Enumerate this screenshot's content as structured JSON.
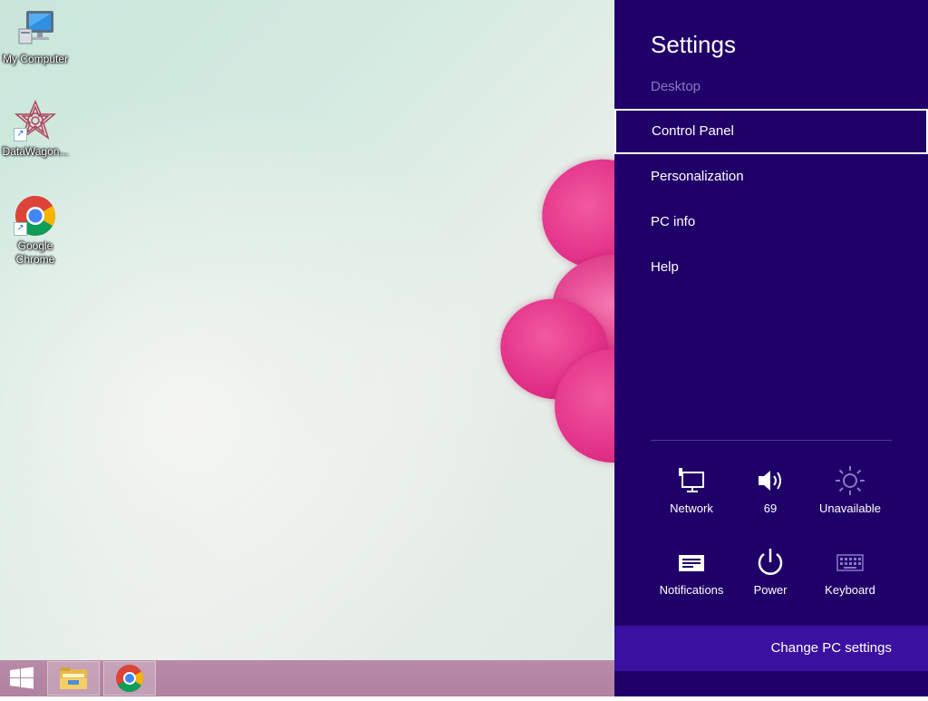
{
  "desktop": {
    "icons": [
      {
        "label": "My Computer",
        "icon": "my-computer-icon"
      },
      {
        "label": "DataWagon...",
        "icon": "datawagon-icon"
      },
      {
        "label": "Google Chrome",
        "icon": "chrome-icon"
      }
    ]
  },
  "taskbar": {
    "start": "windows-logo-icon",
    "pinned": [
      "file-explorer-icon",
      "chrome-icon"
    ]
  },
  "settings_charm": {
    "title": "Settings",
    "context": "Desktop",
    "items": [
      "Control Panel",
      "Personalization",
      "PC info",
      "Help"
    ],
    "selected_item": "Control Panel",
    "quick_settings": [
      {
        "label": "Network",
        "icon": "network-icon"
      },
      {
        "label": "69",
        "icon": "volume-icon"
      },
      {
        "label": "Unavailable",
        "icon": "brightness-icon"
      },
      {
        "label": "Notifications",
        "icon": "notifications-icon"
      },
      {
        "label": "Power",
        "icon": "power-icon"
      },
      {
        "label": "Keyboard",
        "icon": "keyboard-icon"
      }
    ],
    "footer_link": "Change PC settings"
  },
  "colors": {
    "charm_bg": "#1f0068",
    "charm_footer_bg": "#3a10a0",
    "context_text": "#8a78c8",
    "taskbar_bg": "#b083a0",
    "flower": "#e3338a"
  }
}
